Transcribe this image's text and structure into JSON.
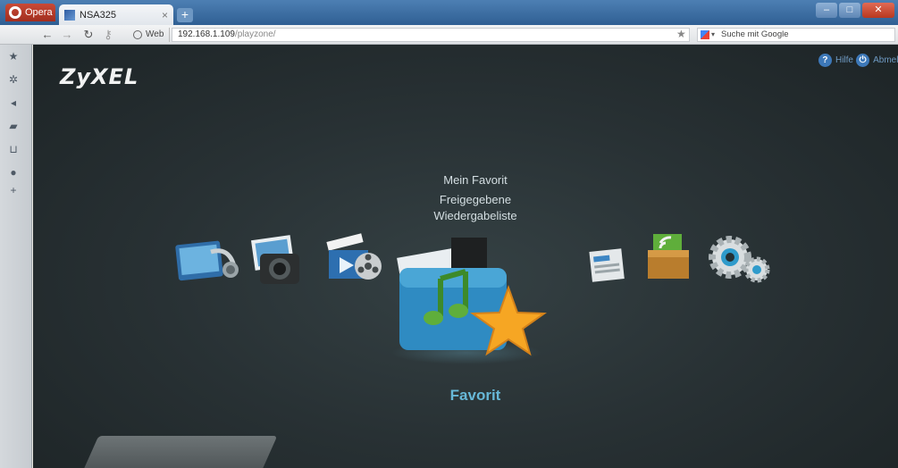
{
  "browser": {
    "menu_label": "Opera",
    "tab_title": "NSA325",
    "tab_close": "×",
    "new_tab": "+",
    "web_badge": "Web",
    "url_host": "192.168.1.109",
    "url_path": "/playzone/",
    "search_placeholder": "Suche mit Google"
  },
  "header": {
    "brand": "ZyXEL",
    "help_label": "Hilfe",
    "logout_label": "Abmeld"
  },
  "menu": {
    "submenu": [
      "Mein Favorit",
      "Freigegebene",
      "Wiedergabeliste"
    ],
    "selected_caption": "Favorit",
    "icons": [
      "music-icon",
      "photo-icon",
      "video-icon",
      "favorite-folder-icon",
      "calendar-icon",
      "rss-box-icon",
      "settings-gears-icon"
    ]
  },
  "colors": {
    "accent": "#67b8d8",
    "background": "#283134",
    "star": "#f6a623"
  }
}
